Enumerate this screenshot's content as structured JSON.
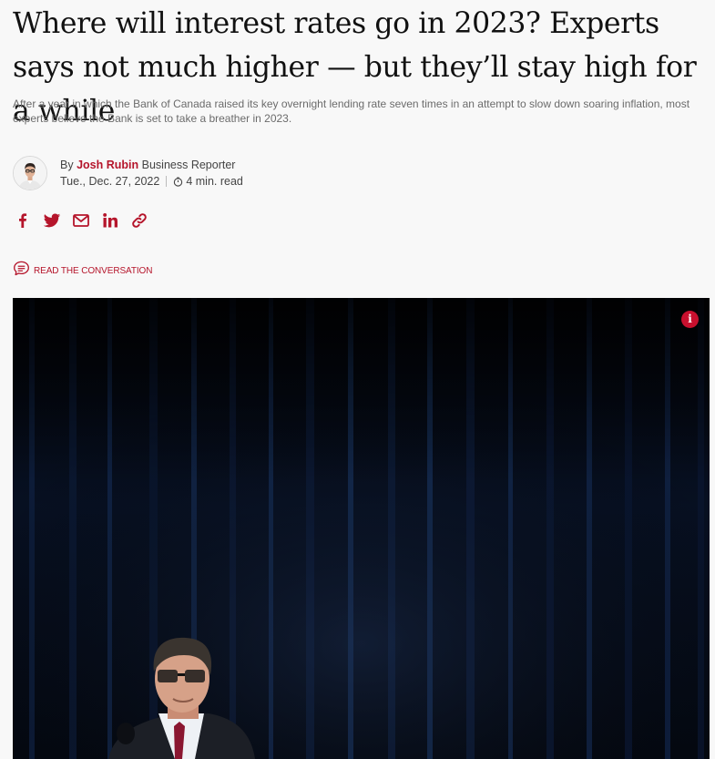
{
  "article": {
    "headline": "Where will interest rates go in 2023? Experts says not much higher — but they’ll stay high for a while",
    "deck": "After a year in which the Bank of Canada raised its key overnight lending rate seven times in an attempt to slow down soaring inflation, most experts believe the Bank is set to take a breather in 2023."
  },
  "byline": {
    "prefix": "By",
    "author": "Josh Rubin",
    "role": "Business Reporter",
    "date": "Tue., Dec. 27, 2022",
    "read_time": "4 min. read"
  },
  "share": {
    "icons": [
      "facebook-icon",
      "twitter-icon",
      "email-icon",
      "linkedin-icon",
      "link-icon"
    ]
  },
  "conversation": {
    "label": "READ THE CONVERSATION"
  },
  "hero": {
    "info_label": "i"
  },
  "colors": {
    "accent": "#b5152b",
    "info_badge": "#c8102e",
    "background": "#f8f8f8",
    "hero_dark": "#04070f"
  }
}
